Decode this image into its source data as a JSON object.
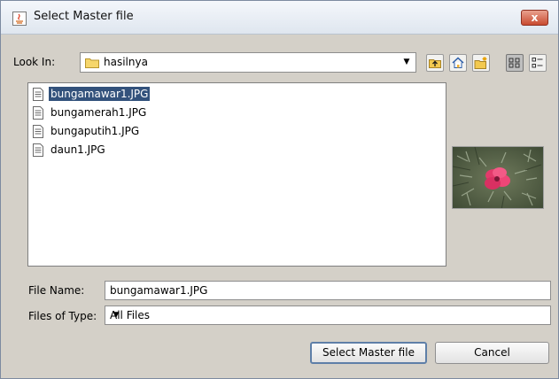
{
  "window": {
    "title": "Select Master file",
    "close_label": "x"
  },
  "look_in": {
    "label": "Look In:",
    "value": "hasilnya"
  },
  "toolbar": {
    "icons": [
      "up-one-level-icon",
      "home-icon",
      "new-folder-icon",
      "list-view-icon",
      "details-view-icon"
    ]
  },
  "files": [
    {
      "name": "bungamawar1.JPG",
      "selected": true
    },
    {
      "name": "bungamerah1.JPG",
      "selected": false
    },
    {
      "name": "bungaputih1.JPG",
      "selected": false
    },
    {
      "name": "daun1.JPG",
      "selected": false
    }
  ],
  "file_name": {
    "label": "File Name:",
    "value": "bungamawar1.JPG"
  },
  "file_type": {
    "label": "Files of Type:",
    "value": "All Files"
  },
  "buttons": {
    "approve": "Select Master file",
    "cancel": "Cancel"
  },
  "colors": {
    "selection": "#33527c",
    "close_button": "#c94b30"
  }
}
